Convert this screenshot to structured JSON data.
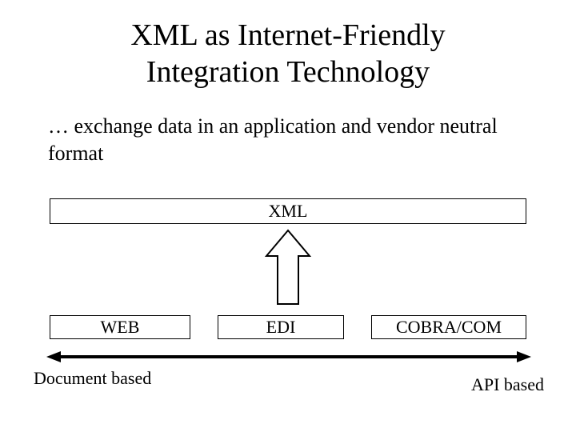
{
  "title_line1": "XML as Internet-Friendly",
  "title_line2": "Integration Technology",
  "subtitle": "… exchange data in an application and vendor neutral format",
  "box_top": "XML",
  "box_left": "WEB",
  "box_mid": "EDI",
  "box_right": "COBRA/COM",
  "axis_left": "Document based",
  "axis_right": "API based"
}
